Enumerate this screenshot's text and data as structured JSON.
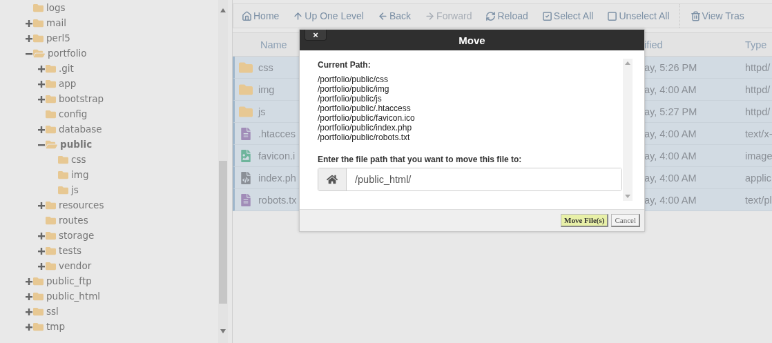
{
  "tree": [
    {
      "name": "logs",
      "kind": "leaf",
      "expanded": false,
      "selected": false
    },
    {
      "name": "mail",
      "kind": "branch",
      "expanded": false,
      "selected": false
    },
    {
      "name": "perl5",
      "kind": "branch",
      "expanded": false,
      "selected": false
    },
    {
      "name": "portfolio",
      "kind": "branch",
      "expanded": true,
      "selected": false,
      "children": [
        {
          "name": ".git",
          "kind": "branch",
          "expanded": false,
          "selected": false
        },
        {
          "name": "app",
          "kind": "branch",
          "expanded": false,
          "selected": false
        },
        {
          "name": "bootstrap",
          "kind": "branch",
          "expanded": false,
          "selected": false
        },
        {
          "name": "config",
          "kind": "leaf",
          "expanded": false,
          "selected": false
        },
        {
          "name": "database",
          "kind": "branch",
          "expanded": false,
          "selected": false
        },
        {
          "name": "public",
          "kind": "branch",
          "expanded": true,
          "selected": true,
          "children": [
            {
              "name": "css",
              "kind": "leaf",
              "expanded": false,
              "selected": false
            },
            {
              "name": "img",
              "kind": "leaf",
              "expanded": false,
              "selected": false
            },
            {
              "name": "js",
              "kind": "leaf",
              "expanded": false,
              "selected": false
            }
          ]
        },
        {
          "name": "resources",
          "kind": "branch",
          "expanded": false,
          "selected": false
        },
        {
          "name": "routes",
          "kind": "leaf",
          "expanded": false,
          "selected": false
        },
        {
          "name": "storage",
          "kind": "branch",
          "expanded": false,
          "selected": false
        },
        {
          "name": "tests",
          "kind": "branch",
          "expanded": false,
          "selected": false
        },
        {
          "name": "vendor",
          "kind": "branch",
          "expanded": false,
          "selected": false
        }
      ]
    },
    {
      "name": "public_ftp",
      "kind": "branch",
      "expanded": false,
      "selected": false
    },
    {
      "name": "public_html",
      "kind": "branch",
      "expanded": false,
      "selected": false
    },
    {
      "name": "ssl",
      "kind": "branch",
      "expanded": false,
      "selected": false
    },
    {
      "name": "tmp",
      "kind": "branch",
      "expanded": false,
      "selected": false
    }
  ],
  "toolbar": [
    {
      "kind": "home",
      "label": "Home",
      "disabled": false
    },
    {
      "kind": "up",
      "label": "Up One Level",
      "disabled": false
    },
    {
      "kind": "back",
      "label": "Back",
      "disabled": false
    },
    {
      "kind": "forward",
      "label": "Forward",
      "disabled": true
    },
    {
      "kind": "reload",
      "label": "Reload",
      "disabled": false
    },
    {
      "kind": "select",
      "label": "Select All",
      "disabled": false
    },
    {
      "kind": "unselect",
      "label": "Unselect All",
      "disabled": false
    },
    {
      "kind": "trash",
      "label": "View Tras",
      "disabled": false
    }
  ],
  "table": {
    "columns": [
      "Name",
      "ified",
      "Type"
    ],
    "rows": [
      {
        "kind": "folder",
        "name": "css",
        "modified": "ay, 5:26 PM",
        "type": "httpd/",
        "selected": true
      },
      {
        "kind": "folder",
        "name": "img",
        "modified": "ay, 4:00 AM",
        "type": "httpd/",
        "selected": true
      },
      {
        "kind": "folder",
        "name": "js",
        "modified": "ay, 5:27 PM",
        "type": "httpd/",
        "selected": true
      },
      {
        "kind": "text",
        "name": ".htacces",
        "modified": "ay, 4:00 AM",
        "type": "text/x-",
        "selected": true
      },
      {
        "kind": "image",
        "name": "favicon.i",
        "modified": "ay, 4:00 AM",
        "type": "image",
        "selected": true
      },
      {
        "kind": "code",
        "name": "index.ph",
        "modified": "ay, 4:00 AM",
        "type": "applic",
        "selected": true
      },
      {
        "kind": "text",
        "name": "robots.tx",
        "modified": "ay, 4:00 AM",
        "type": "text/pl",
        "selected": true
      }
    ]
  },
  "dialog": {
    "title": "Move",
    "close": "×",
    "current_path_label": "Current Path:",
    "paths": [
      "/portfolio/public/css",
      "/portfolio/public/img",
      "/portfolio/public/js",
      "/portfolio/public/.htaccess",
      "/portfolio/public/favicon.ico",
      "/portfolio/public/index.php",
      "/portfolio/public/robots.txt"
    ],
    "destination_label": "Enter the file path that you want to move this file to:",
    "destination": "/public_html/",
    "buttons": [
      {
        "label": "Move File(s)",
        "primary": true
      },
      {
        "label": "Cancel",
        "primary": false
      }
    ]
  }
}
